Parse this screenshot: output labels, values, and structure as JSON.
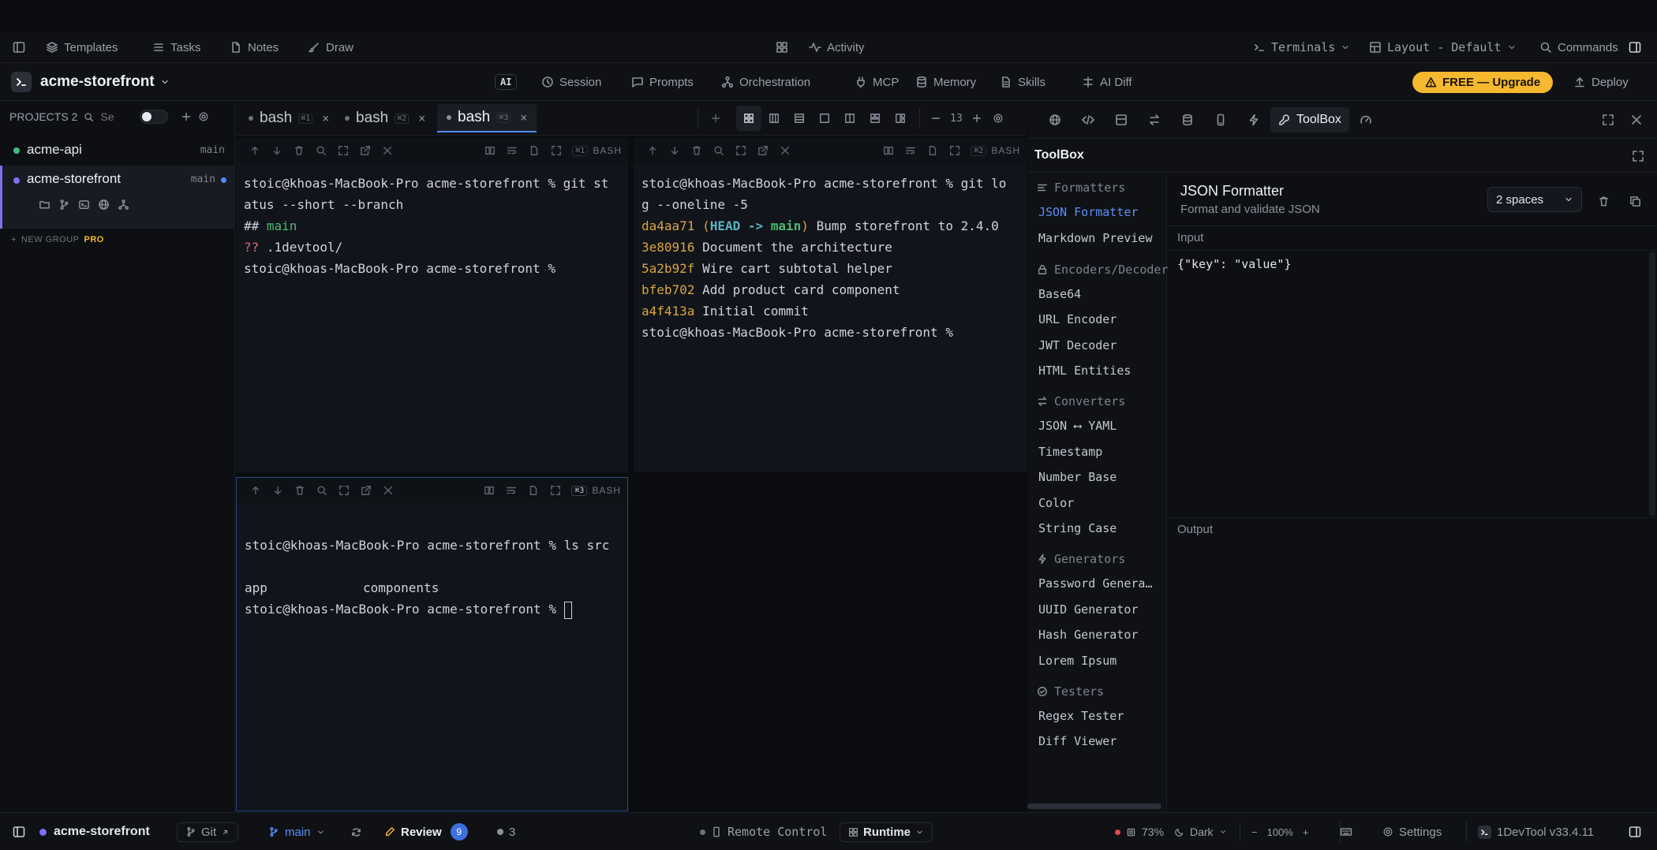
{
  "topnav": {
    "templates": "Templates",
    "tasks": "Tasks",
    "notes": "Notes",
    "draw": "Draw",
    "activity": "Activity",
    "terminals": "Terminals",
    "layout": "Layout - Default",
    "commands": "Commands"
  },
  "project_bar": {
    "project_name": "acme-storefront",
    "ai_badge": "AI",
    "session": "Session",
    "prompts": "Prompts",
    "orchestration": "Orchestration",
    "mcp": "MCP",
    "memory": "Memory",
    "skills": "Skills",
    "ai_diff": "AI Diff",
    "upgrade": "FREE — Upgrade",
    "deploy": "Deploy"
  },
  "sidebar": {
    "projects_label": "PROJECTS 2",
    "search_placeholder": "Se",
    "projects": [
      {
        "name": "acme-api",
        "branch": "main",
        "color": "#3fbf7f"
      },
      {
        "name": "acme-storefront",
        "branch": "main",
        "color": "#7b72f0"
      }
    ],
    "new_group": "NEW GROUP",
    "pro_badge": "PRO"
  },
  "terminal_tabs": [
    {
      "label": "bash",
      "key": "⌘1"
    },
    {
      "label": "bash",
      "key": "⌘2"
    },
    {
      "label": "bash",
      "key": "⌘3"
    }
  ],
  "font_size": "13",
  "panes": {
    "p1": {
      "key": "⌘1",
      "shell": "BASH",
      "lines": {
        "l1": "stoic@khoas-MacBook-Pro acme-storefront % git st",
        "l2": "atus --short --branch",
        "l3a": "## ",
        "l3b": "main",
        "l4a": "??",
        "l4b": " .1devtool/",
        "l5": "stoic@khoas-MacBook-Pro acme-storefront %"
      }
    },
    "p2": {
      "key": "⌘2",
      "shell": "BASH",
      "lines": {
        "l1": "stoic@khoas-MacBook-Pro acme-storefront % git lo",
        "l2": "g --oneline -5",
        "c1hash": "da4aa71",
        "c1open": " (",
        "c1head": "HEAD -> ",
        "c1branch": "main",
        "c1close": ")",
        "c1msg": " Bump storefront to 2.4.0",
        "c2hash": "3e80916",
        "c2msg": " Document the architecture",
        "c3hash": "5a2b92f",
        "c3msg": " Wire cart subtotal helper",
        "c4hash": "bfeb702",
        "c4msg": " Add product card component",
        "c5hash": "a4f413a",
        "c5msg": " Initial commit",
        "l8": "stoic@khoas-MacBook-Pro acme-storefront %"
      }
    },
    "p3": {
      "key": "⌘3",
      "shell": "BASH",
      "lines": {
        "l1": "stoic@khoas-MacBook-Pro acme-storefront % ls src",
        "l2a": "app",
        "l2b": "components",
        "l3": "stoic@khoas-MacBook-Pro acme-storefront %"
      }
    }
  },
  "toolbox": {
    "tab_label": "ToolBox",
    "panel_title": "ToolBox",
    "categories": {
      "formatters": "Formatters",
      "encoders": "Encoders/Decoders",
      "converters": "Converters",
      "generators": "Generators",
      "testers": "Testers"
    },
    "tools": {
      "json_formatter": "JSON Formatter",
      "markdown_preview": "Markdown Preview",
      "base64": "Base64",
      "url_encoder": "URL Encoder",
      "jwt_decoder": "JWT Decoder",
      "html_entities": "HTML Entities",
      "json_yaml": "JSON ⟷ YAML",
      "timestamp": "Timestamp",
      "number_base": "Number Base",
      "color": "Color",
      "string_case": "String Case",
      "password_generator": "Password Genera…",
      "uuid_generator": "UUID Generator",
      "hash_generator": "Hash Generator",
      "lorem_ipsum": "Lorem Ipsum",
      "regex_tester": "Regex Tester",
      "diff_viewer": "Diff Viewer"
    },
    "formatter": {
      "title": "JSON Formatter",
      "subtitle": "Format and validate JSON",
      "indent": "2 spaces",
      "input_label": "Input",
      "input_value": "{\"key\": \"value\"}",
      "output_label": "Output"
    }
  },
  "statusbar": {
    "project": "acme-storefront",
    "git": "Git",
    "branch": "main",
    "review": "Review",
    "review_count": "9",
    "dot_count": "3",
    "remote_control": "Remote Control",
    "runtime": "Runtime",
    "cpu": "73%",
    "theme": "Dark",
    "zoom": "100%",
    "settings": "Settings",
    "version": "1DevTool v33.4.11"
  }
}
